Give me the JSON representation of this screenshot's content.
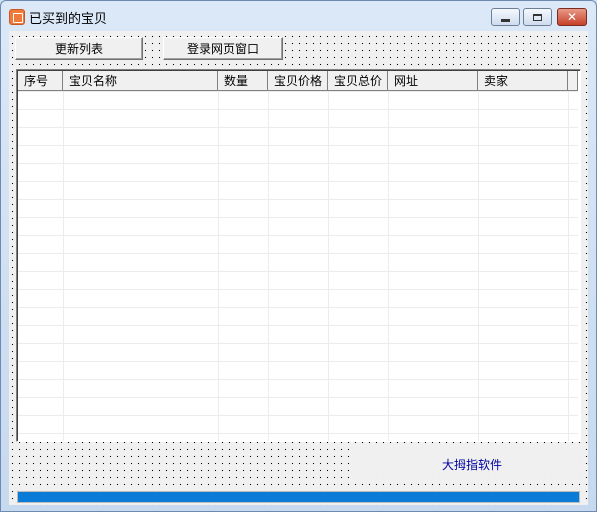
{
  "window": {
    "title": "已买到的宝贝",
    "icon": "app-icon"
  },
  "titlebar_buttons": {
    "minimize": "minimize-icon",
    "maximize": "maximize-icon",
    "close": "close-icon",
    "close_glyph": "✕"
  },
  "toolbar": {
    "refresh_label": "更新列表",
    "login_label": "登录网页窗口"
  },
  "table": {
    "columns": [
      "序号",
      "宝贝名称",
      "数量",
      "宝贝价格",
      "宝贝总价",
      "网址",
      "卖家"
    ],
    "rows": []
  },
  "footer": {
    "brand": "大拇指软件"
  },
  "progress": {
    "value": 1.0,
    "color": "#0a7bd6"
  }
}
